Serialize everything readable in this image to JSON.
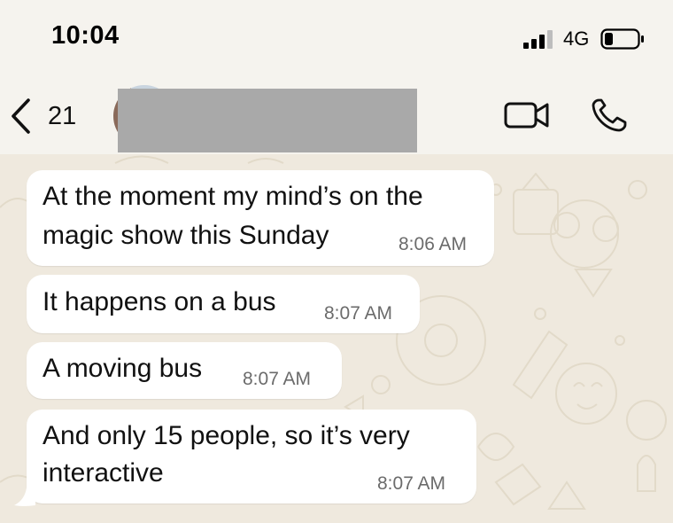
{
  "status_bar": {
    "time": "10:04",
    "network": "4G",
    "icons": [
      "signal-bars-icon",
      "battery-icon"
    ]
  },
  "header": {
    "back_count": "21",
    "icons": [
      "chevron-left-icon",
      "video-camera-icon",
      "phone-icon"
    ]
  },
  "colors": {
    "chat_background": "#efe9de",
    "bubble_incoming": "#ffffff",
    "redaction": "#a9a9a9"
  },
  "messages": [
    {
      "lines": [
        "At the moment my mind’s on the",
        "magic show this Sunday"
      ],
      "time": "8:06 AM"
    },
    {
      "lines": [
        "It happens on a bus"
      ],
      "time": "8:07 AM"
    },
    {
      "lines": [
        "A moving bus"
      ],
      "time": "8:07 AM"
    },
    {
      "lines": [
        "And only 15 people, so it’s very",
        "interactive"
      ],
      "time": "8:07 AM"
    }
  ]
}
